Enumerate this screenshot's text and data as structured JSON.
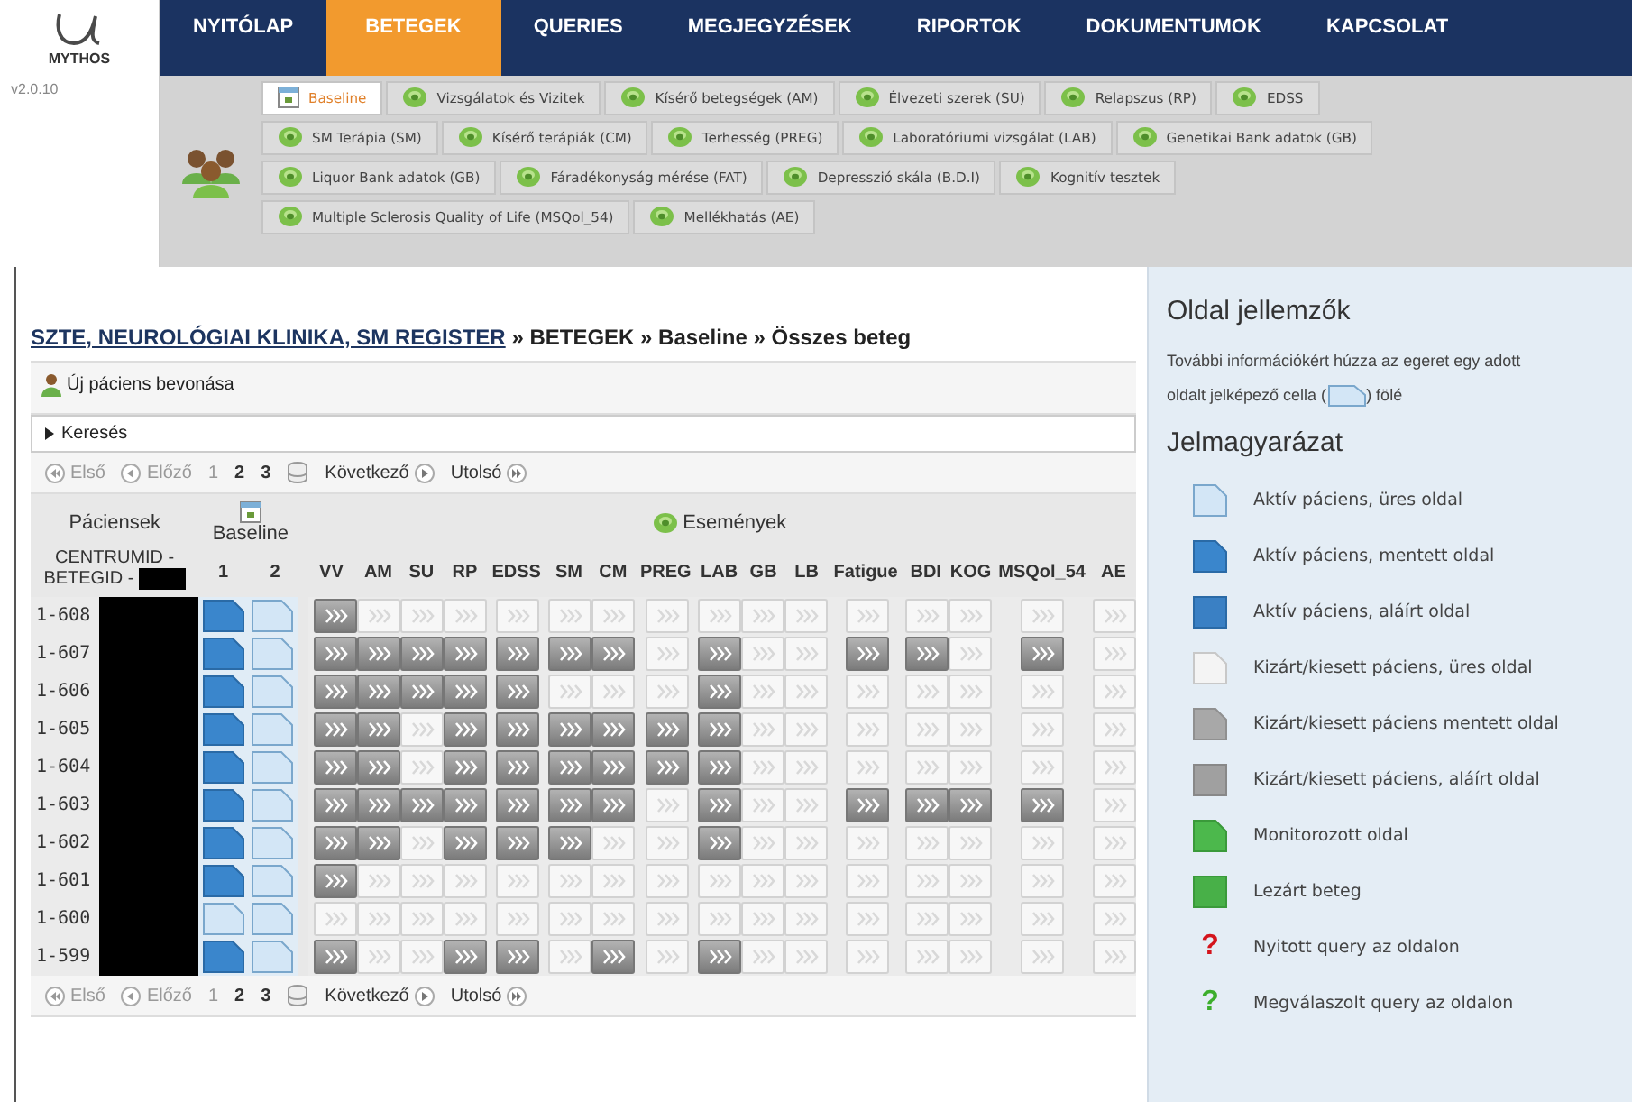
{
  "logo": {
    "name": "MYTHOS",
    "version": "v2.0.10"
  },
  "nav": [
    {
      "label": "NYITÓLAP",
      "selected": false
    },
    {
      "label": "BETEGEK",
      "selected": true
    },
    {
      "label": "QUERIES",
      "selected": false
    },
    {
      "label": "MEGJEGYZÉSEK",
      "selected": false
    },
    {
      "label": "RIPORTOK",
      "selected": false
    },
    {
      "label": "DOKUMENTUMOK",
      "selected": false
    },
    {
      "label": "KAPCSOLAT",
      "selected": false
    }
  ],
  "subtabs": [
    [
      {
        "label": "Baseline",
        "kind": "page",
        "selected": true
      },
      {
        "label": "Vizsgálatok és Vizitek",
        "kind": "event",
        "selected": false
      },
      {
        "label": "Kísérő betegségek (AM)",
        "kind": "event",
        "selected": false
      },
      {
        "label": "Élvezeti szerek (SU)",
        "kind": "event",
        "selected": false
      },
      {
        "label": "Relapszus (RP)",
        "kind": "event",
        "selected": false
      },
      {
        "label": "EDSS",
        "kind": "event",
        "selected": false
      }
    ],
    [
      {
        "label": "SM Terápia (SM)",
        "kind": "event",
        "selected": false
      },
      {
        "label": "Kísérő terápiák (CM)",
        "kind": "event",
        "selected": false
      },
      {
        "label": "Terhesség (PREG)",
        "kind": "event",
        "selected": false
      },
      {
        "label": "Laboratóriumi vizsgálat (LAB)",
        "kind": "event",
        "selected": false
      },
      {
        "label": "Genetikai Bank adatok (GB)",
        "kind": "event",
        "selected": false
      }
    ],
    [
      {
        "label": "Liquor Bank adatok (GB)",
        "kind": "event",
        "selected": false
      },
      {
        "label": "Fáradékonyság mérése (FAT)",
        "kind": "event",
        "selected": false
      },
      {
        "label": "Depresszió skála (B.D.I)",
        "kind": "event",
        "selected": false
      },
      {
        "label": "Kognitív tesztek",
        "kind": "event",
        "selected": false
      }
    ],
    [
      {
        "label": "Multiple Sclerosis Quality of Life (MSQol_54)",
        "kind": "event",
        "selected": false
      },
      {
        "label": "Mellékhatás (AE)",
        "kind": "event",
        "selected": false
      }
    ]
  ],
  "breadcrumb": {
    "link": "SZTE, NEUROLÓGIAI KLINIKA, SM REGISTER",
    "rest": "» BETEGEK » Baseline » Összes beteg"
  },
  "add_patient": "Új páciens bevonása",
  "search": {
    "label": "Keresés",
    "expanded": false
  },
  "pager_top": {
    "first": "Első",
    "prev": "Előző",
    "pages": [
      {
        "label": "1",
        "selected": true
      },
      {
        "label": "2",
        "selected": false
      },
      {
        "label": "3",
        "selected": false
      }
    ],
    "next": "Következő",
    "last": "Utolsó"
  },
  "table": {
    "patients_header": "Páciensek",
    "baseline_header": "Baseline",
    "events_header": "Események",
    "id_header": [
      "CENTRUMID -",
      "BETEGID -"
    ],
    "baseline_columns": [
      "1",
      "2"
    ],
    "event_columns": [
      "VV",
      "AM",
      "SU",
      "RP",
      "EDSS",
      "SM",
      "CM",
      "PREG",
      "LAB",
      "GB",
      "LB",
      "Fatigue",
      "BDI",
      "KOG",
      "MSQol_54",
      "AE"
    ],
    "rows": [
      {
        "id": "1-608",
        "baseline": [
          {
            "saved": true
          },
          {
            "saved": false
          }
        ],
        "events": [
          true,
          false,
          false,
          false,
          false,
          false,
          false,
          false,
          false,
          false,
          false,
          false,
          false,
          false,
          false,
          false
        ]
      },
      {
        "id": "1-607",
        "baseline": [
          {
            "saved": true
          },
          {
            "saved": false
          }
        ],
        "events": [
          true,
          true,
          true,
          true,
          true,
          true,
          true,
          false,
          true,
          false,
          false,
          true,
          true,
          false,
          true,
          false
        ]
      },
      {
        "id": "1-606",
        "baseline": [
          {
            "saved": true
          },
          {
            "saved": false
          }
        ],
        "events": [
          true,
          true,
          true,
          true,
          true,
          false,
          false,
          false,
          true,
          false,
          false,
          false,
          false,
          false,
          false,
          false
        ]
      },
      {
        "id": "1-605",
        "baseline": [
          {
            "saved": true
          },
          {
            "saved": false
          }
        ],
        "events": [
          true,
          true,
          false,
          true,
          true,
          true,
          true,
          true,
          true,
          false,
          false,
          false,
          false,
          false,
          false,
          false
        ]
      },
      {
        "id": "1-604",
        "baseline": [
          {
            "saved": true
          },
          {
            "saved": false
          }
        ],
        "events": [
          true,
          true,
          false,
          true,
          true,
          true,
          true,
          true,
          true,
          false,
          false,
          false,
          false,
          false,
          false,
          false
        ]
      },
      {
        "id": "1-603",
        "baseline": [
          {
            "saved": true
          },
          {
            "saved": false
          }
        ],
        "events": [
          true,
          true,
          true,
          true,
          true,
          true,
          true,
          false,
          true,
          false,
          false,
          true,
          true,
          true,
          true,
          false
        ]
      },
      {
        "id": "1-602",
        "baseline": [
          {
            "saved": true
          },
          {
            "saved": false
          }
        ],
        "events": [
          true,
          true,
          false,
          true,
          true,
          true,
          false,
          false,
          true,
          false,
          false,
          false,
          false,
          false,
          false,
          false
        ]
      },
      {
        "id": "1-601",
        "baseline": [
          {
            "saved": true
          },
          {
            "saved": false
          }
        ],
        "events": [
          true,
          false,
          false,
          false,
          false,
          false,
          false,
          false,
          false,
          false,
          false,
          false,
          false,
          false,
          false,
          false
        ]
      },
      {
        "id": "1-600",
        "baseline": [
          {
            "saved": false
          },
          {
            "saved": false
          }
        ],
        "events": [
          false,
          false,
          false,
          false,
          false,
          false,
          false,
          false,
          false,
          false,
          false,
          false,
          false,
          false,
          false,
          false
        ]
      },
      {
        "id": "1-599",
        "baseline": [
          {
            "saved": true
          },
          {
            "saved": false
          }
        ],
        "events": [
          true,
          false,
          false,
          true,
          true,
          false,
          true,
          false,
          true,
          false,
          false,
          false,
          false,
          false,
          false,
          false
        ]
      }
    ]
  },
  "pager_bottom": {
    "first": "Első",
    "prev": "Előző",
    "pages": [
      {
        "label": "1",
        "selected": true
      },
      {
        "label": "2",
        "selected": false
      },
      {
        "label": "3",
        "selected": false
      }
    ],
    "next": "Következő",
    "last": "Utolsó"
  },
  "sidebar": {
    "title": "Oldal jellemzők",
    "info_line": "További információkért húzza az egeret egy adott",
    "info_before": "oldalt jelképező cella (",
    "info_after": ") fölé",
    "legend_title": "Jelmagyarázat",
    "legend": [
      {
        "kind": "active-empty",
        "label": "Aktív páciens, üres oldal"
      },
      {
        "kind": "active-saved",
        "label": "Aktív páciens, mentett oldal"
      },
      {
        "kind": "active-signed",
        "label": "Aktív páciens, aláírt oldal"
      },
      {
        "kind": "excluded-empty",
        "label": "Kizárt/kiesett páciens, üres oldal"
      },
      {
        "kind": "excluded-saved",
        "label": "Kizárt/kiesett páciens mentett oldal"
      },
      {
        "kind": "excluded-signed",
        "label": "Kizárt/kiesett páciens, aláírt oldal"
      },
      {
        "kind": "monitored",
        "label": "Monitorozott oldal"
      },
      {
        "kind": "closed",
        "label": "Lezárt beteg"
      },
      {
        "kind": "query-open",
        "mark": "?",
        "label": "Nyitott query az oldalon"
      },
      {
        "kind": "query-answered",
        "mark": "?",
        "label": "Megválaszolt query az oldalon"
      }
    ]
  }
}
